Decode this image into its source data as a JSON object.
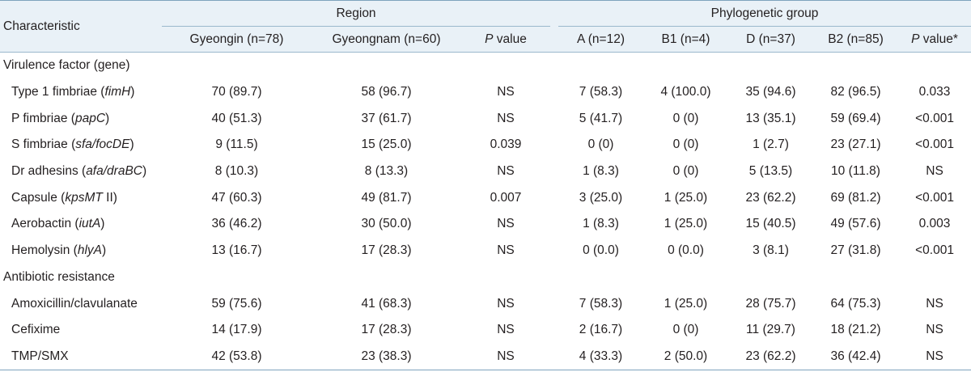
{
  "header": {
    "characteristic": "Characteristic",
    "region": "Region",
    "phylo": "Phylogenetic group",
    "cols": {
      "gyeongin": "Gyeongin (n=78)",
      "gyeongnam": "Gyeongnam (n=60)",
      "p_italic": "P",
      "p_rest": " value",
      "a": "A (n=12)",
      "b1": "B1 (n=4)",
      "d": "D (n=37)",
      "b2": "B2 (n=85)",
      "p2_italic": "P",
      "p2_rest": " value*"
    }
  },
  "sections": [
    {
      "title": "Virulence factor (gene)",
      "rows": [
        {
          "pre": "Type 1 fimbriae (",
          "gene": "fimH",
          "post": ")",
          "vals": [
            "70 (89.7)",
            "58 (96.7)",
            "NS",
            "7 (58.3)",
            "4 (100.0)",
            "35 (94.6)",
            "82 (96.5)",
            "0.033"
          ]
        },
        {
          "pre": "P fimbriae (",
          "gene": "papC",
          "post": ")",
          "vals": [
            "40 (51.3)",
            "37 (61.7)",
            "NS",
            "5 (41.7)",
            "0 (0)",
            "13 (35.1)",
            "59 (69.4)",
            "<0.001"
          ]
        },
        {
          "pre": "S fimbriae (",
          "gene": "sfa/focDE",
          "post": ")",
          "vals": [
            "9 (11.5)",
            "15 (25.0)",
            "0.039",
            "0 (0)",
            "0 (0)",
            "1 (2.7)",
            "23 (27.1)",
            "<0.001"
          ]
        },
        {
          "pre": "Dr adhesins (",
          "gene": "afa/draBC",
          "post": ")",
          "vals": [
            "8 (10.3)",
            "8 (13.3)",
            "NS",
            "1 (8.3)",
            "0 (0)",
            "5 (13.5)",
            "10 (11.8)",
            "NS"
          ]
        },
        {
          "pre": "Capsule (",
          "gene": "kpsMT",
          "post": " II)",
          "vals": [
            "47 (60.3)",
            "49 (81.7)",
            "0.007",
            "3 (25.0)",
            "1 (25.0)",
            "23 (62.2)",
            "69 (81.2)",
            "<0.001"
          ]
        },
        {
          "pre": "Aerobactin (",
          "gene": "iutA",
          "post": ")",
          "vals": [
            "36 (46.2)",
            "30 (50.0)",
            "NS",
            "1 (8.3)",
            "1 (25.0)",
            "15 (40.5)",
            "49 (57.6)",
            "0.003"
          ]
        },
        {
          "pre": "Hemolysin (",
          "gene": "hlyA",
          "post": ")",
          "vals": [
            "13 (16.7)",
            "17 (28.3)",
            "NS",
            "0 (0.0)",
            "0 (0.0)",
            "3 (8.1)",
            "27 (31.8)",
            "<0.001"
          ]
        }
      ]
    },
    {
      "title": "Antibiotic resistance",
      "rows": [
        {
          "pre": "Amoxicillin/clavulanate",
          "gene": "",
          "post": "",
          "vals": [
            "59 (75.6)",
            "41 (68.3)",
            "NS",
            "7 (58.3)",
            "1 (25.0)",
            "28 (75.7)",
            "64 (75.3)",
            "NS"
          ]
        },
        {
          "pre": "Cefixime",
          "gene": "",
          "post": "",
          "vals": [
            "14 (17.9)",
            "17 (28.3)",
            "NS",
            "2 (16.7)",
            "0 (0)",
            "11 (29.7)",
            "18 (21.2)",
            "NS"
          ]
        },
        {
          "pre": "TMP/SMX",
          "gene": "",
          "post": "",
          "vals": [
            "42 (53.8)",
            "23 (38.3)",
            "NS",
            "4 (33.3)",
            "2 (50.0)",
            "23 (62.2)",
            "36 (42.4)",
            "NS"
          ]
        }
      ]
    }
  ]
}
